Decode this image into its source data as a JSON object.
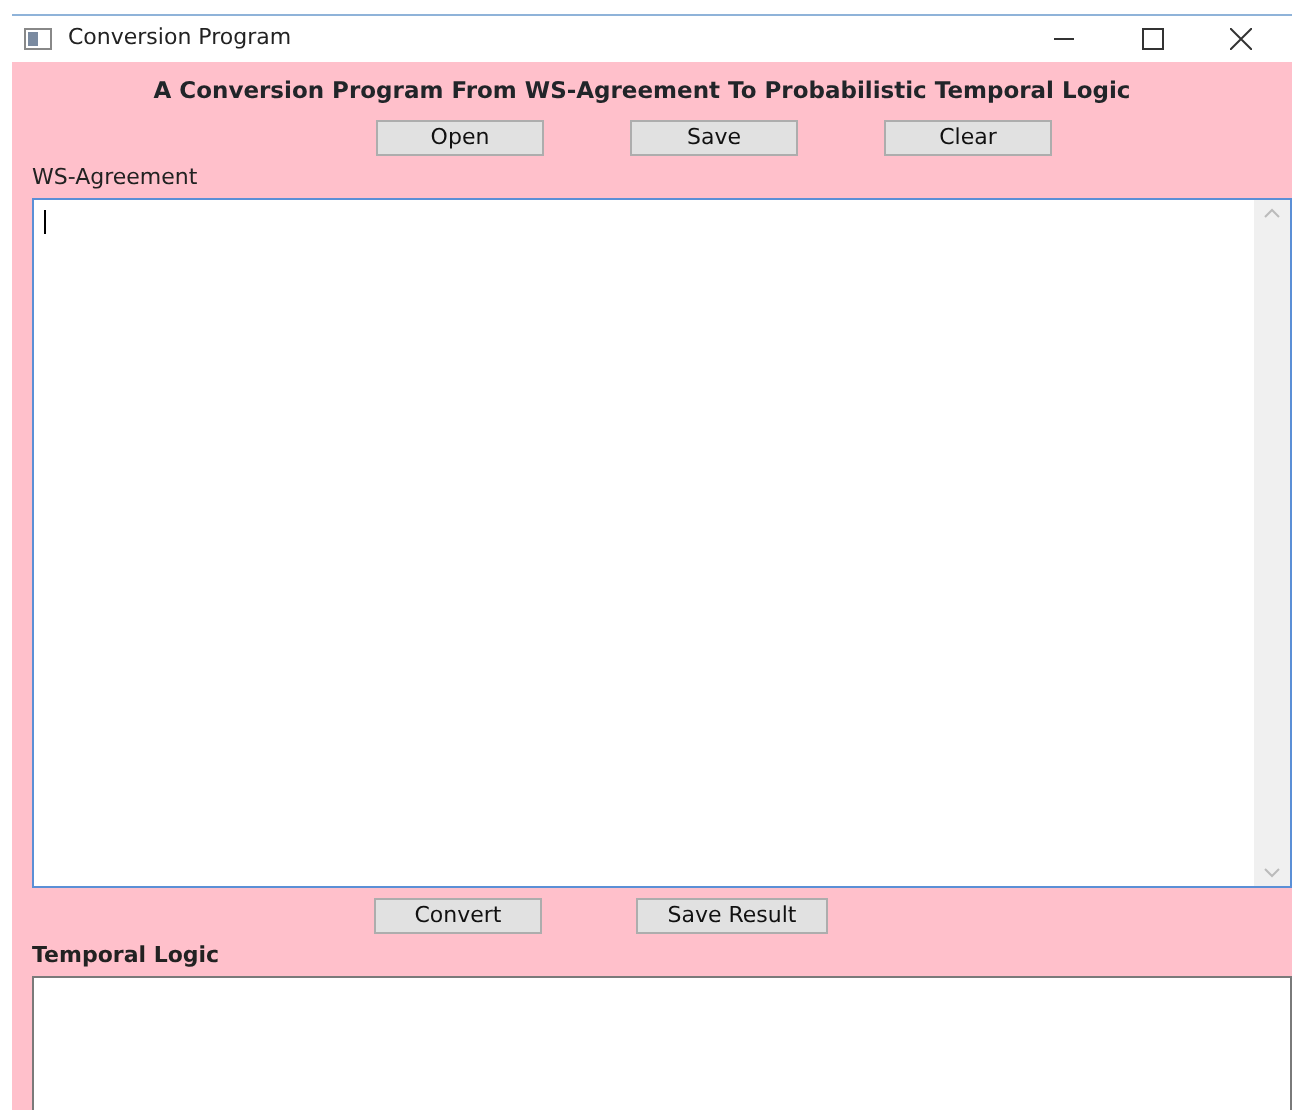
{
  "window": {
    "title": "Conversion Program"
  },
  "heading": "A Conversion Program From WS-Agreement To Probabilistic Temporal Logic",
  "top_buttons": [
    "Open",
    "Save",
    "Clear"
  ],
  "input": {
    "label": "WS-Agreement",
    "focused": true
  },
  "bottom_buttons": [
    "Convert",
    "Save Result"
  ],
  "output": {
    "label": "Temporal Logic"
  }
}
